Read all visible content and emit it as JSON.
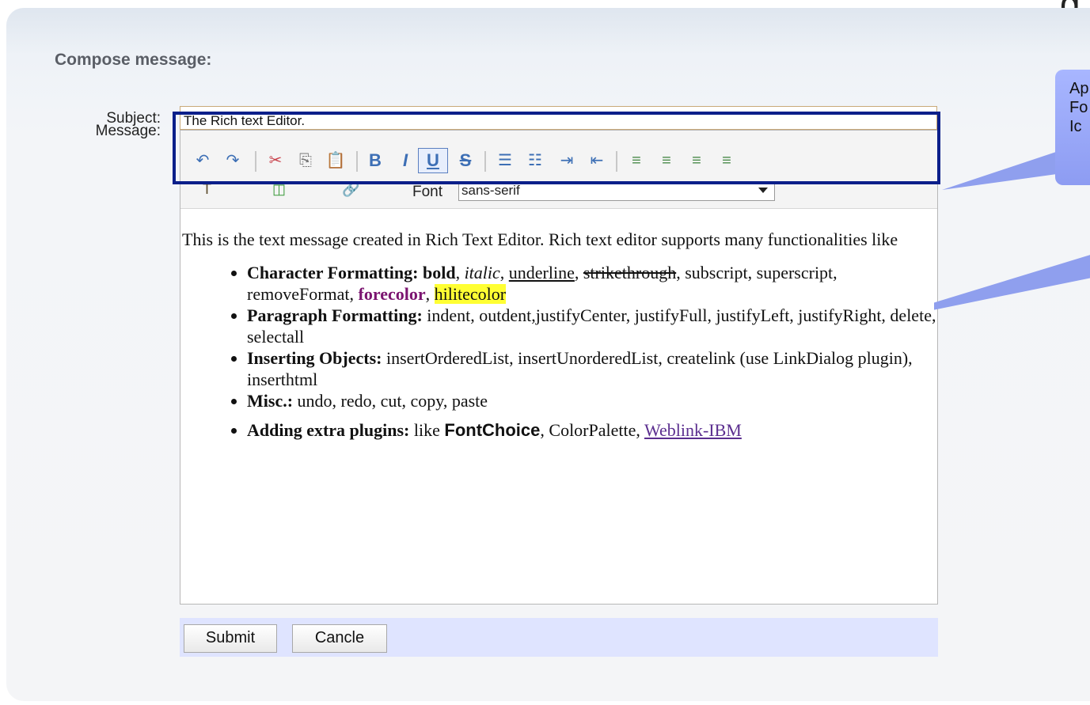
{
  "page": {
    "title": "Compose message:",
    "corner_char": "g"
  },
  "labels": {
    "subject": "Subject:",
    "message": "Message:"
  },
  "subject": {
    "value": "The Rich text Editor."
  },
  "toolbar": {
    "icons": [
      "undo-icon",
      "redo-icon",
      "cut-icon",
      "copy-icon",
      "paste-icon",
      "bold-icon",
      "italic-icon",
      "underline-icon",
      "strikethrough-icon",
      "ordered-list-icon",
      "unordered-list-icon",
      "indent-icon",
      "outdent-icon",
      "justify-left-icon",
      "justify-center-icon",
      "justify-right-icon",
      "justify-full-icon"
    ],
    "font_label": "Font",
    "font_value": "sans-serif"
  },
  "content": {
    "intro": "This is the text message created in Rich Text Editor. Rich text editor supports many functionalities like",
    "items": [
      {
        "label": "Character Formatting:",
        "parts": {
          "bold": "bold",
          "italic": "italic",
          "underline": "underline",
          "strike": "strikethrough",
          "rest": "subscript, superscript, removeFormat,",
          "forecolor": "forecolor",
          "hilitecolor": "hilitecolor"
        }
      },
      {
        "label": "Paragraph Formatting:",
        "text": "indent, outdent,justifyCenter, justifyFull, justifyLeft, justifyRight, delete, selectall"
      },
      {
        "label": "Inserting Objects:",
        "text": "insertOrderedList, insertUnorderedList, createlink (use LinkDialog plugin), inserthtml"
      },
      {
        "label": "Misc.:",
        "text": "undo, redo, cut, copy, paste"
      },
      {
        "label": "Adding extra plugins:",
        "like": "like",
        "fontchoice": "FontChoice",
        "colorpalette": "ColorPalette,",
        "link": "Weblink-IBM"
      }
    ]
  },
  "buttons": {
    "submit": "Submit",
    "cancel": "Cancle"
  },
  "callout": {
    "line1": "Ap",
    "line2": "Fo",
    "line3": "Ic"
  },
  "colors": {
    "highlight_border": "#0b1f8a",
    "forecolor": "#7b1470",
    "hilite": "#ffff33",
    "callout": "#95a6f6"
  }
}
